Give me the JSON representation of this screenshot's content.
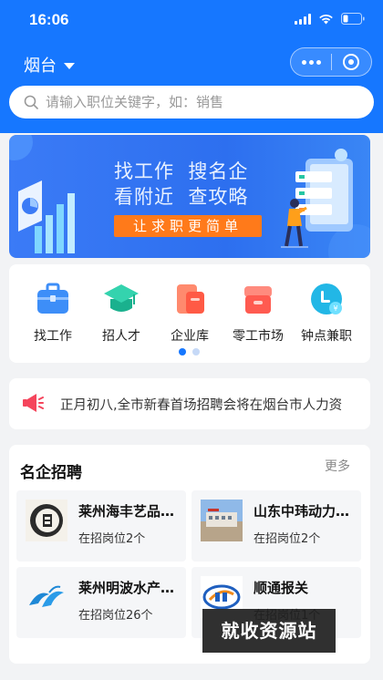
{
  "status_bar": {
    "time": "16:06"
  },
  "header": {
    "city": "烟台"
  },
  "search": {
    "placeholder": "请输入职位关键字，如：销售"
  },
  "banner": {
    "line1": "找工作  搜名企",
    "line2": "看附近  查攻略",
    "button_label": "让求职更简单"
  },
  "nav": {
    "items": [
      {
        "label": "找工作",
        "icon": "briefcase-icon",
        "color": "#3d8ef8"
      },
      {
        "label": "招人才",
        "icon": "graduation-cap-icon",
        "color": "#21c5a0"
      },
      {
        "label": "企业库",
        "icon": "company-library-icon",
        "color": "#ff6a55"
      },
      {
        "label": "零工市场",
        "icon": "store-icon",
        "color": "#ff6a5e"
      },
      {
        "label": "钟点兼职",
        "icon": "hourly-job-icon",
        "color": "#22b7e6"
      }
    ],
    "active_page": 1,
    "page_count": 2
  },
  "notice": {
    "text": "正月初八,全市新春首场招聘会将在烟台市人力资"
  },
  "companies": {
    "title": "名企招聘",
    "more_label": "更多",
    "items": [
      {
        "name": "莱州海丰艺品…",
        "jobs": "在招岗位2个"
      },
      {
        "name": "山东中玮动力…",
        "jobs": "在招岗位2个"
      },
      {
        "name": "莱州明波水产…",
        "jobs": "在招岗位26个"
      },
      {
        "name": "顺通报关",
        "jobs": "在招岗位1个"
      }
    ]
  },
  "watermark": {
    "text": "就收资源站"
  },
  "colors": {
    "primary": "#1677ff",
    "accent_orange": "#ff7a1a",
    "notice_red": "#f5455c"
  }
}
